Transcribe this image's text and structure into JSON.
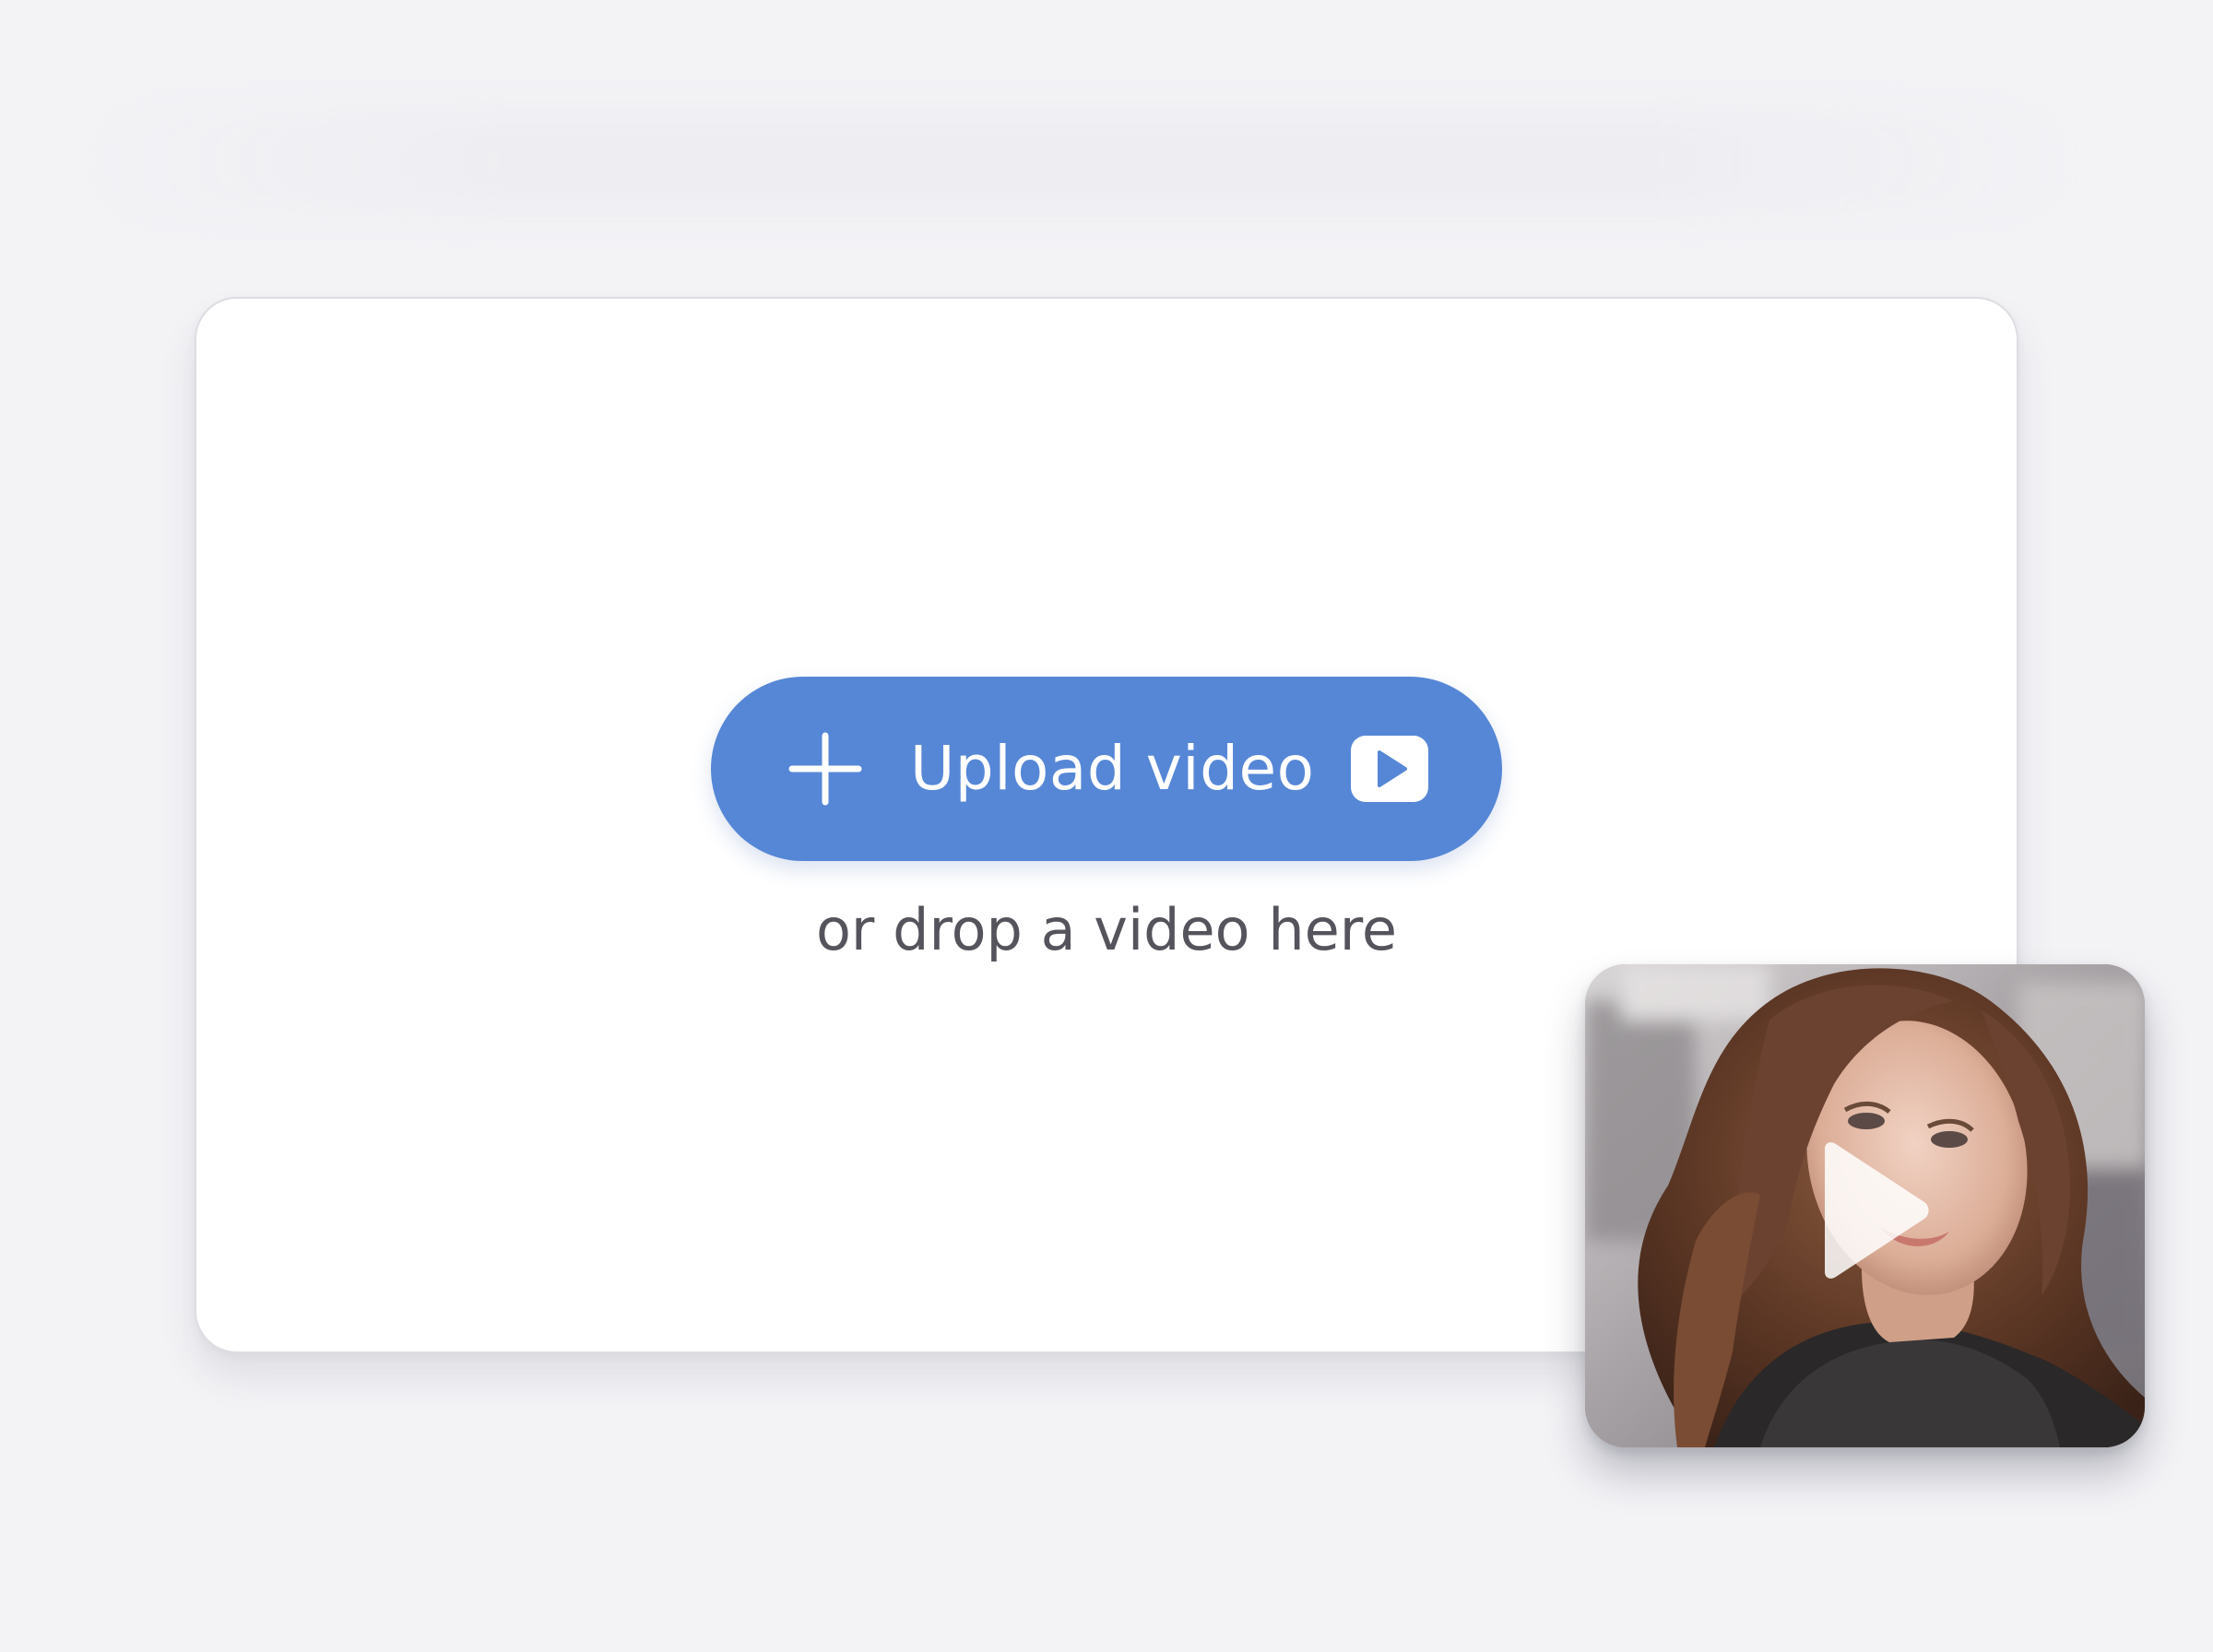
{
  "upload": {
    "button_label": "Upload video",
    "drop_hint": "or drop a video here",
    "plus_icon": "plus-icon",
    "video_icon": "youtube-play-icon"
  },
  "thumbnail": {
    "play_icon": "play-icon"
  },
  "colors": {
    "background": "#f3f3f6",
    "card": "#ffffff",
    "accent": "#5687d6",
    "hint_text": "#55545c"
  }
}
